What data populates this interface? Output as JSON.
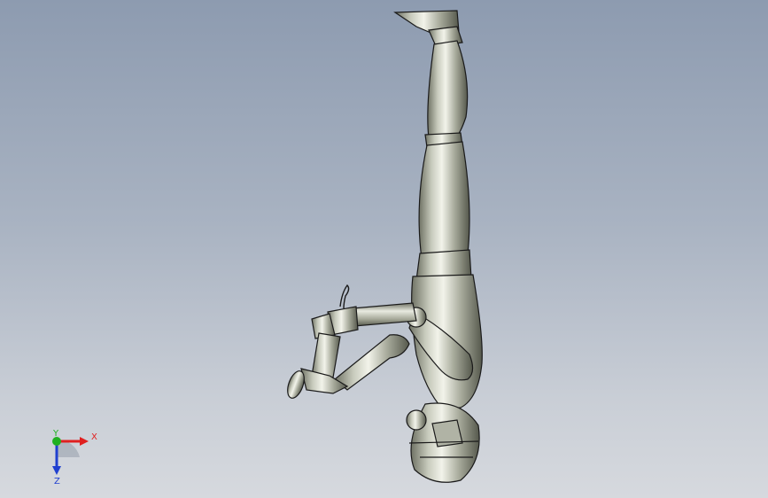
{
  "viewport": {
    "background_top": "#8d9bb0",
    "background_bottom": "#d6d9de",
    "model": "robot-assembly"
  },
  "triad": {
    "x_label": "X",
    "y_label": "Y",
    "z_label": "Z",
    "x_color": "#e02020",
    "y_color": "#20b020",
    "z_color": "#2040d0"
  }
}
